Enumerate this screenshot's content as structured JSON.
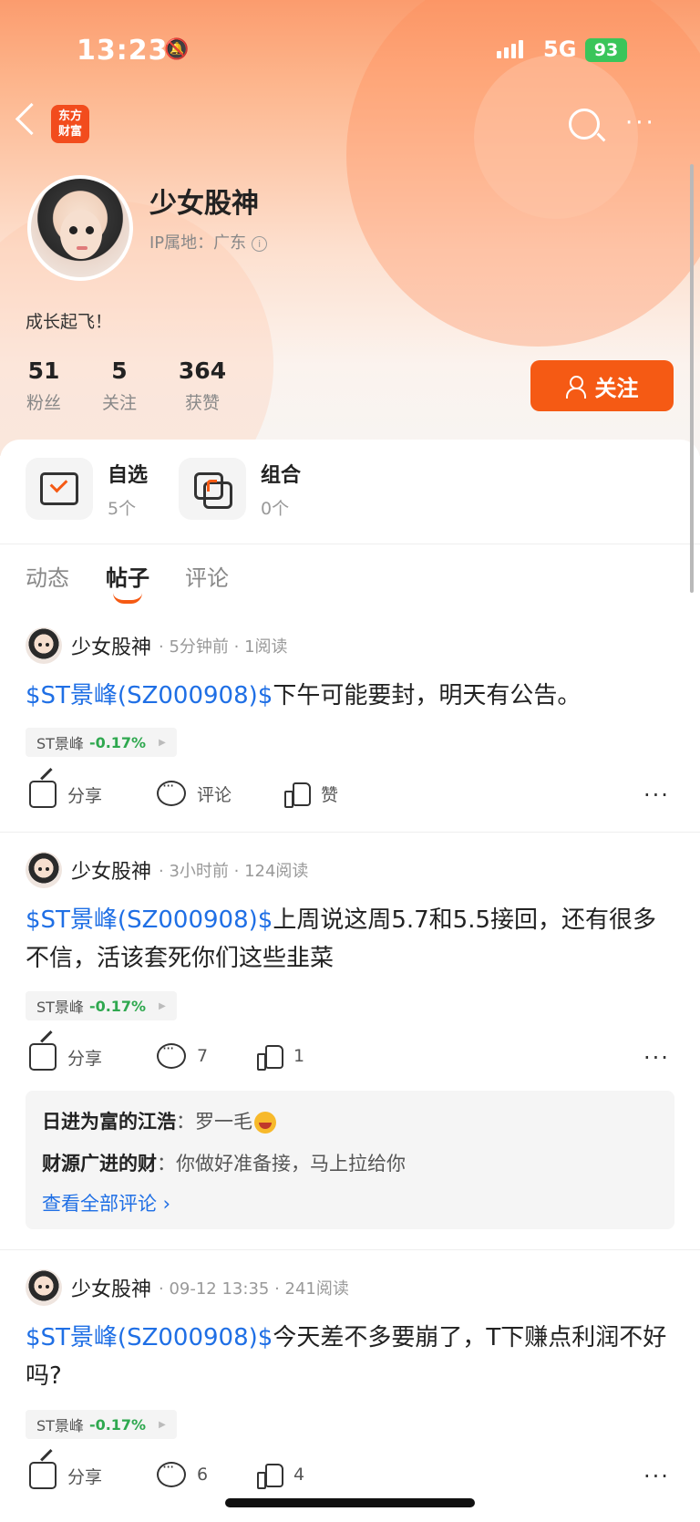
{
  "status_bar": {
    "time": "13:23",
    "network": "5G",
    "battery": "93"
  },
  "header": {
    "logo_text": "东方\n财富",
    "logo_line1": "东方",
    "logo_line2": "财富"
  },
  "profile": {
    "name": "少女股神",
    "ip_location": "IP属地：广东",
    "bio": "成长起飞！",
    "stats": [
      {
        "value": "51",
        "label": "粉丝"
      },
      {
        "value": "5",
        "label": "关注"
      },
      {
        "value": "364",
        "label": "获赞"
      }
    ],
    "follow_label": "关注"
  },
  "quick": [
    {
      "title": "自选",
      "sub": "5个"
    },
    {
      "title": "组合",
      "sub": "0个"
    }
  ],
  "tabs": [
    "动态",
    "帖子",
    "评论"
  ],
  "active_tab": "帖子",
  "actions": {
    "share": "分享",
    "comment": "评论",
    "like": "赞"
  },
  "posts": [
    {
      "author": "少女股神",
      "meta": "· 5分钟前 · 1阅读",
      "tag": "$ST景峰(SZ000908)$",
      "text": "下午可能要封，明天有公告。",
      "stock": {
        "name": "ST景峰",
        "pct": "-0.17%"
      },
      "comment_count": "评论",
      "like_count": "赞"
    },
    {
      "author": "少女股神",
      "meta": "· 3小时前 · 124阅读",
      "tag": "$ST景峰(SZ000908)$",
      "text": "上周说这周5.7和5.5接回，还有很多不信，活该套死你们这些韭菜",
      "stock": {
        "name": "ST景峰",
        "pct": "-0.17%"
      },
      "comment_count": "7",
      "like_count": "1",
      "comments": [
        {
          "user": "日进为富的江浩",
          "text": "罗一毛"
        },
        {
          "user": "财源广进的财",
          "text": "你做好准备接，马上拉给你"
        }
      ],
      "view_all": "查看全部评论 ›"
    },
    {
      "author": "少女股神",
      "meta": "· 09-12 13:35 · 241阅读",
      "tag": "$ST景峰(SZ000908)$",
      "text": "今天差不多要崩了，T下赚点利润不好吗?",
      "stock": {
        "name": "ST景峰",
        "pct": "-0.17%"
      },
      "comment_count": "6",
      "like_count": "4"
    }
  ],
  "colors": {
    "accent": "#f55a14",
    "link": "#1f6fe5",
    "down": "#2fa84f"
  }
}
